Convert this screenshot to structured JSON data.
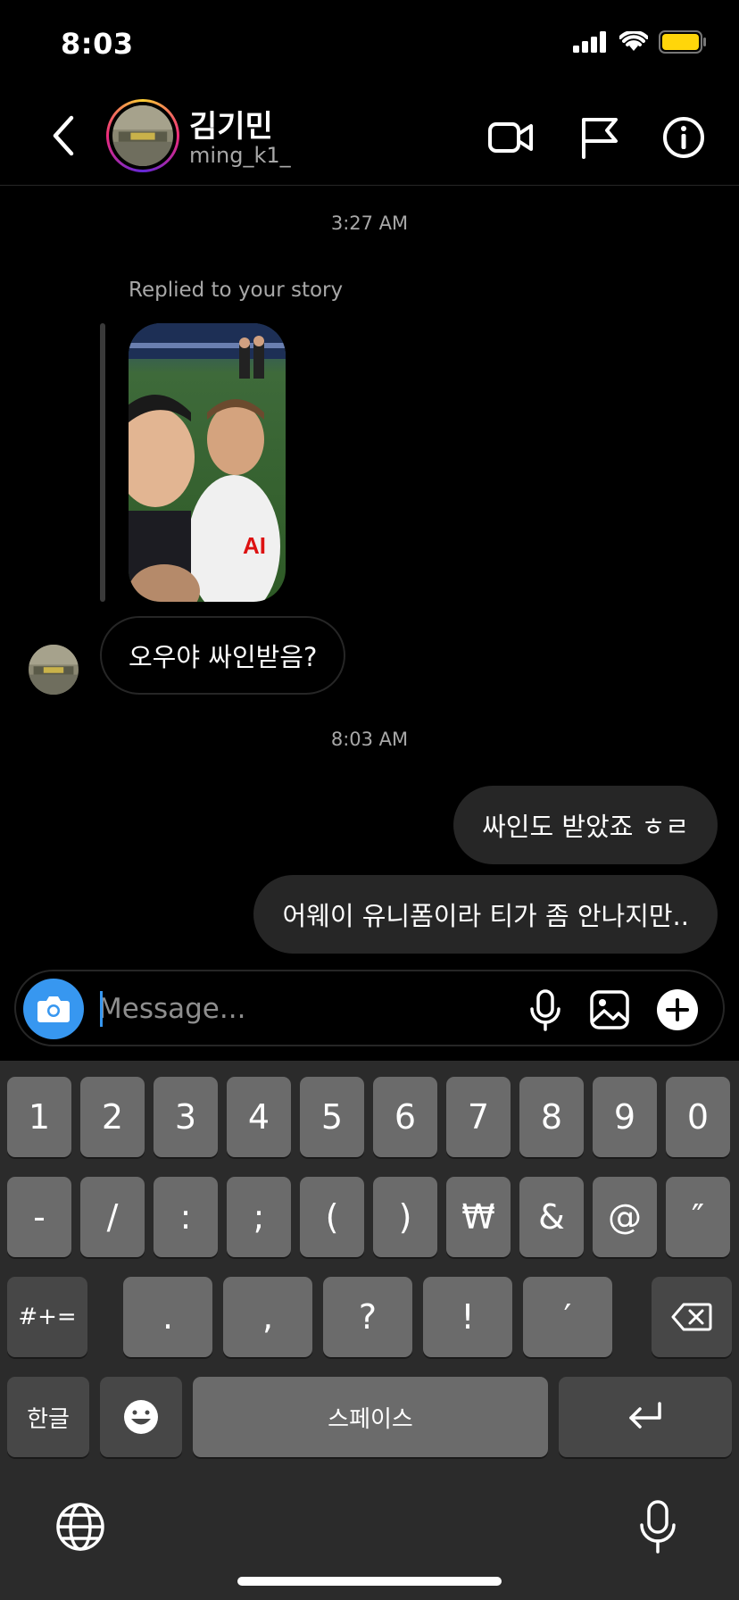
{
  "status_bar": {
    "time": "8:03"
  },
  "header": {
    "name": "김기민",
    "username": "ming_k1_",
    "icons": [
      "back-arrow-icon",
      "video-call-icon",
      "flag-icon",
      "info-icon"
    ]
  },
  "chat": {
    "timestamp_1": "3:27 AM",
    "reply_label": "Replied to your story",
    "incoming_message": "오우야 싸인받음?",
    "timestamp_2": "8:03 AM",
    "outgoing_messages": [
      "싸인도 받았죠 ㅎㄹ",
      "어웨이 유니폼이라 티가 좀 안나지만.."
    ]
  },
  "composer": {
    "placeholder": "Message...",
    "value": "",
    "icons": [
      "camera-icon",
      "microphone-icon",
      "gallery-icon",
      "plus-icon"
    ]
  },
  "keyboard": {
    "row1": [
      "1",
      "2",
      "3",
      "4",
      "5",
      "6",
      "7",
      "8",
      "9",
      "0"
    ],
    "row2": [
      "-",
      "/",
      ":",
      ";",
      "(",
      ")",
      "₩",
      "&",
      "@",
      "″"
    ],
    "row3_left": "#+=",
    "row3": [
      ".",
      ",",
      "?",
      "!",
      "′"
    ],
    "korean_key": "한글",
    "space": "스페이스",
    "icons": [
      "delete-icon",
      "emoji-icon",
      "return-icon",
      "globe-icon",
      "dictation-icon"
    ]
  },
  "colors": {
    "accent": "#3797f0",
    "bubble_out": "#262626",
    "battery": "#ffd60a"
  }
}
